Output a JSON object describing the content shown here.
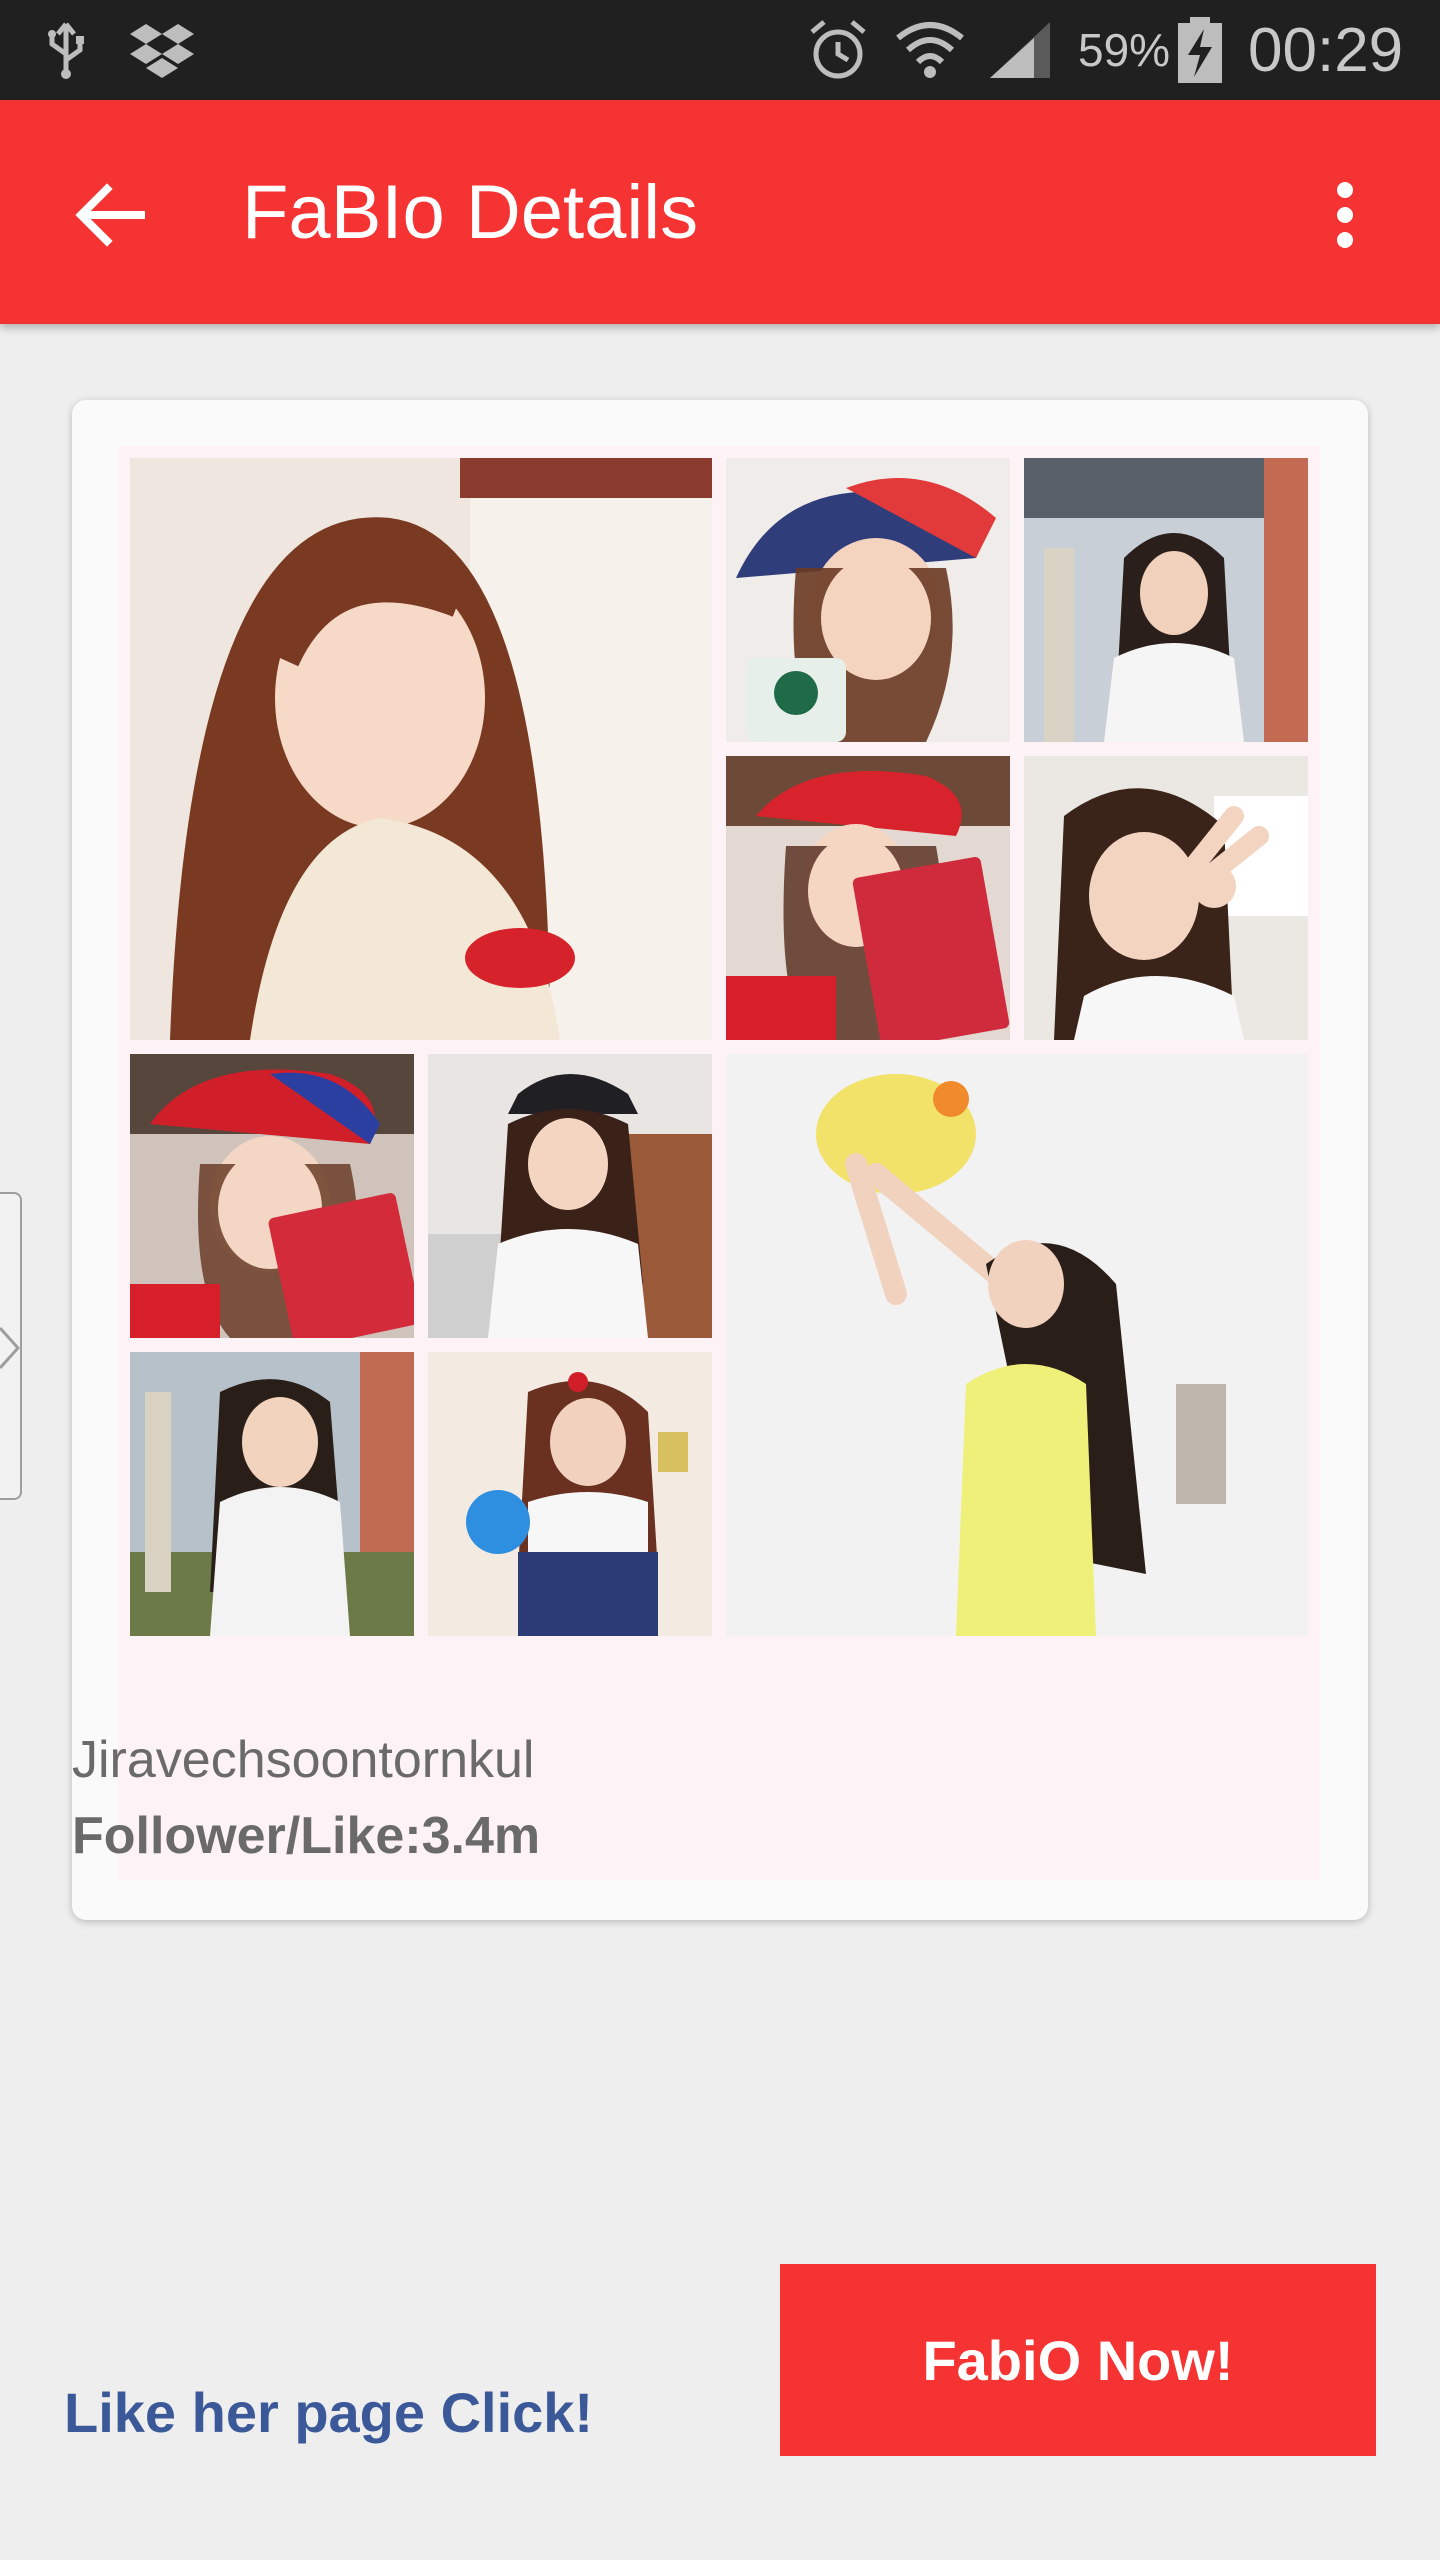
{
  "status_bar": {
    "battery": "59%",
    "time": "00:29",
    "icons": [
      "usb-icon",
      "dropbox-icon",
      "alarm-icon",
      "wifi-icon",
      "signal-icon",
      "battery-charging-icon"
    ]
  },
  "app_bar": {
    "title": "FaBIo Details",
    "back_icon": "arrow-back-icon",
    "menu_icon": "more-vert-icon"
  },
  "profile": {
    "name": "Jiravechsoontornkul",
    "followers": "Follower/Like:3.4m",
    "photos": [
      "photo-smiling-selfie",
      "photo-cap-drink",
      "photo-window-outdoor",
      "photo-cap-book",
      "photo-peace-sign",
      "photo-cap-book-2",
      "photo-car-seat",
      "photo-yellow-toy",
      "photo-outdoor-shirt",
      "photo-blue-ball"
    ]
  },
  "actions": {
    "like_link": "Like her page Click!",
    "fabio_button": "FabiO Now!"
  },
  "colors": {
    "accent": "#f53333",
    "link": "#3b5998",
    "background": "#eeeeee",
    "status_bar": "#202020"
  }
}
